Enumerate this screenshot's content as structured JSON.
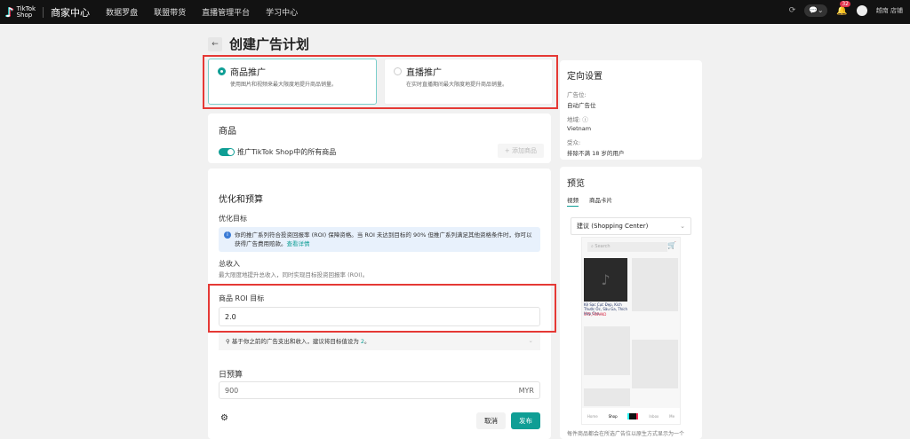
{
  "topbar": {
    "logo_line1": "TikTok",
    "logo_line2": "Shop",
    "brand": "商家中心",
    "nav": [
      "数据罗盘",
      "联盟带货",
      "直播管理平台",
      "学习中心"
    ],
    "notification_count": "32",
    "shop_name": "越南 店铺"
  },
  "page": {
    "title": "创建广告计划"
  },
  "promotion_types": [
    {
      "title": "商品推广",
      "desc": "使用图片和视频来最大限度地提升商品销量。",
      "selected": true
    },
    {
      "title": "直播推广",
      "desc": "在实时直播期间最大限度地提升商品销量。",
      "selected": false
    }
  ],
  "products": {
    "title": "商品",
    "toggle_label": "推广TikTok Shop中的所有商品",
    "add_button": "+ 添加商品"
  },
  "optimization": {
    "title": "优化和预算",
    "goal_label": "优化目标",
    "info_text": "你的推广系列符合投资回报率 (ROI) 保障资格。当 ROI 未达到目标的 90% 但推广系列满足其他资格条件时，你可以获得广告费用赔款。",
    "info_link": "查看详情",
    "revenue_title": "总收入",
    "revenue_desc": "最大限度地提升总收入，同时实现目标投资回报率 (ROI)。",
    "roi_label": "商品 ROI 目标",
    "roi_value": "2.0",
    "hint_text": "基于你之前的广告支出和收入，建议将目标值设为",
    "hint_value": "2",
    "hint_suffix": "。",
    "budget_label": "日预算",
    "budget_value": "900",
    "currency": "MYR",
    "cancel": "取消",
    "publish": "发布"
  },
  "targeting": {
    "title": "定向设置",
    "placement_label": "广告位:",
    "placement_value": "自动广告位",
    "location_label": "地域:",
    "location_value": "Vietnam",
    "audience_label": "受众:",
    "audience_value": "排除不满 18 岁的用户"
  },
  "preview": {
    "title": "预览",
    "tabs": [
      "视频",
      "商品卡片"
    ],
    "select": "建议 (Shopping Center)",
    "search": "Search",
    "product_title": "Kệ Sạc Cực Đẹp, Kích Thước Ốc, Sâu Ga, Thích Hợp Cho...",
    "product_price": "375,700VND",
    "nav": [
      "Home",
      "Shop",
      "",
      "Inbox",
      "Me"
    ],
    "footer": "每件商品都会在所选广告位以原生方式显示为一个"
  },
  "colors": {
    "accent": "#0f9e95",
    "highlight": "#e53935"
  }
}
